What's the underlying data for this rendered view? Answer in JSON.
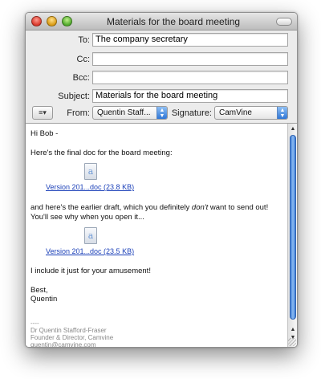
{
  "window": {
    "title": "Materials for the board meeting"
  },
  "header": {
    "to_label": "To:",
    "to_value": "The company secretary",
    "cc_label": "Cc:",
    "cc_value": "",
    "bcc_label": "Bcc:",
    "bcc_value": "",
    "subject_label": "Subject:",
    "subject_value": "Materials for the board meeting",
    "from_label": "From:",
    "from_value": "Quentin Staff...",
    "signature_label": "Signature:",
    "signature_value": "CamVine",
    "menu_glyph": "≡▾"
  },
  "body": {
    "greeting": "Hi Bob -",
    "line1": "Here's the final doc for the board meeting:",
    "attachment1": {
      "name": "Version 201...doc (23.8 KB)",
      "icon": "word-document-icon"
    },
    "line2_start": "and here's the earlier draft, which you definitely ",
    "line2_emph": "don't",
    "line2_end": " want to send out!",
    "line3": "You'll see why when you open it...",
    "attachment2": {
      "name": "Version 201...doc (23.5 KB)",
      "icon": "word-document-icon"
    },
    "line4": "I include it just for your amusement!",
    "closing": "Best,",
    "name": "Quentin",
    "sig_sep": "----",
    "sig1": "Dr Quentin Stafford-Fraser",
    "sig2": "Founder & Director, Camvine",
    "sig3": "quentin@camvine.com"
  },
  "colors": {
    "link": "#1a3fb8",
    "scroll_thumb": "#3f7ed8",
    "popup_arrow": "#2f76d6"
  }
}
